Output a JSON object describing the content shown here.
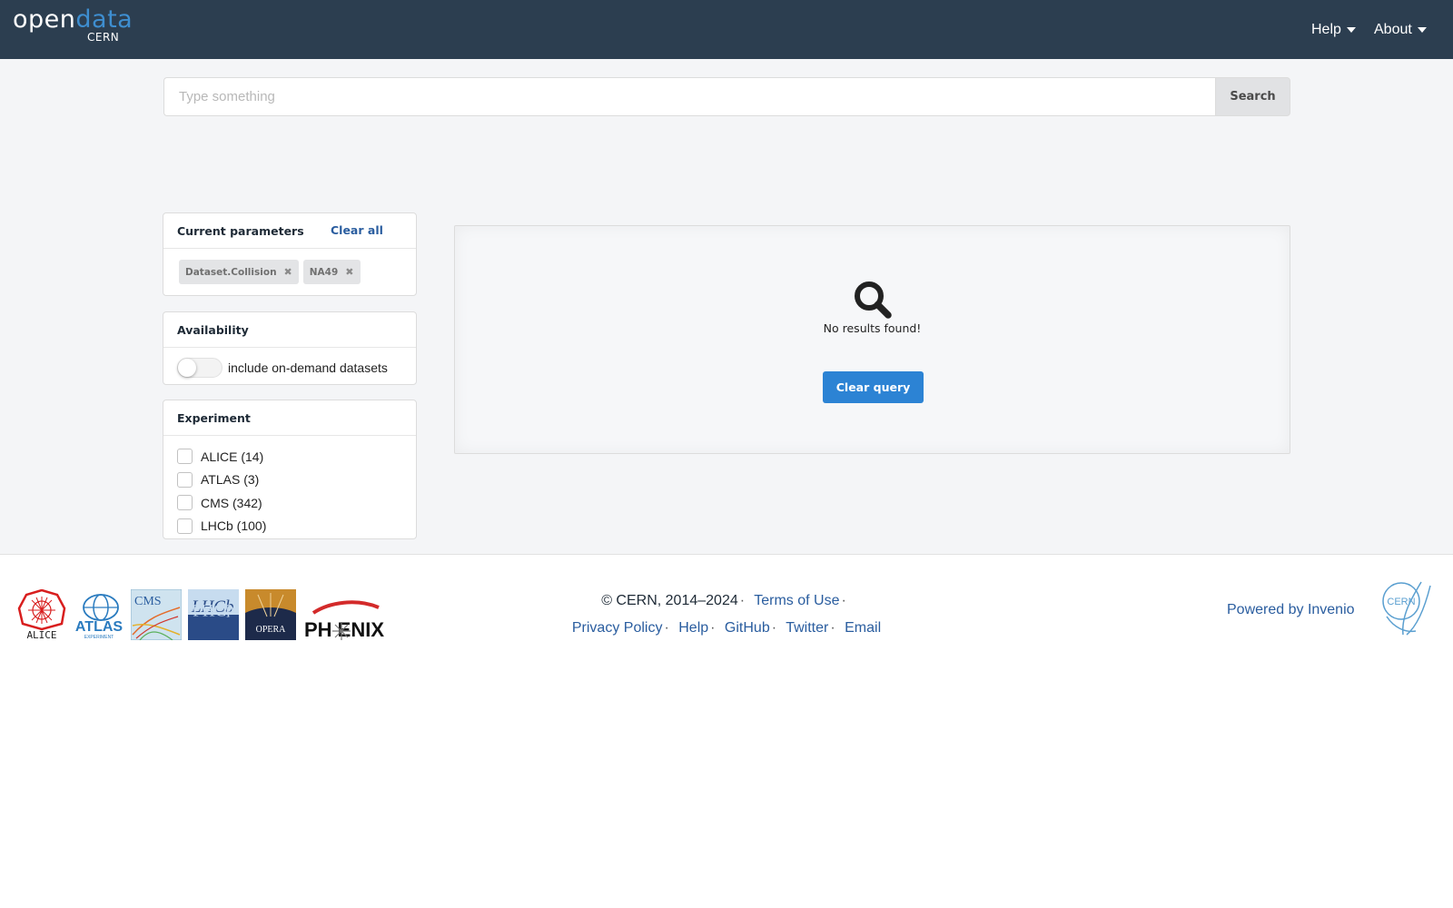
{
  "header": {
    "logo_open": "open",
    "logo_data": "data",
    "logo_org": "CERN",
    "menu_help": "Help",
    "menu_about": "About"
  },
  "search": {
    "placeholder": "Type something",
    "button_label": "Search"
  },
  "current_parameters": {
    "title": "Current parameters",
    "clear_all_label": "Clear all",
    "chips": [
      "Dataset.Collision",
      "NA49"
    ],
    "chip_remove_icon": "times-icon"
  },
  "availability": {
    "title": "Availability",
    "toggle_label": "include on-demand datasets",
    "toggle_on": false
  },
  "experiment": {
    "title": "Experiment",
    "options": [
      {
        "label": "ALICE (14)",
        "checked": false
      },
      {
        "label": "ATLAS (3)",
        "checked": false
      },
      {
        "label": "CMS (342)",
        "checked": false
      },
      {
        "label": "LHCb (100)",
        "checked": false
      }
    ]
  },
  "results": {
    "icon": "search-icon",
    "message": "No results found!",
    "clear_query_label": "Clear query"
  },
  "footer": {
    "experiment_logos": [
      "ALICE",
      "ATLAS",
      "CMS",
      "LHCb",
      "OPERA",
      "PHENIX"
    ],
    "logo_alice_text": "ALICE",
    "logo_atlas_text": "ATLAS",
    "logo_atlas_sub": "EXPERIMENT",
    "logo_cms_text": "CMS",
    "logo_lhcb_text": "LHCb",
    "logo_opera_text": "OPERA",
    "logo_phenix_text": "PH ENIX",
    "copyright": "© CERN, 2014–2024",
    "terms": "Terms of Use",
    "privacy": "Privacy Policy",
    "help": "Help",
    "github": "GitHub",
    "twitter": "Twitter",
    "email": "Email",
    "powered_by": "Powered by Invenio",
    "cern_logo_text": "CERN"
  },
  "colors": {
    "navbar": "#2c3e50",
    "accent_blue": "#2c83d4",
    "link_blue": "#2a5d9f",
    "logo_data_blue": "#3e8ed0",
    "background_grey": "#f4f5f7"
  }
}
